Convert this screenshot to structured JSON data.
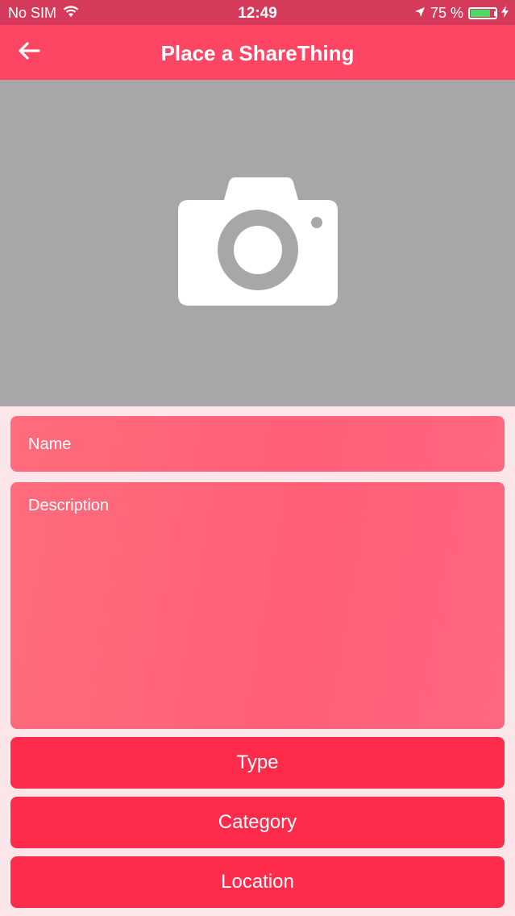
{
  "status_bar": {
    "carrier": "No SIM",
    "time": "12:49",
    "battery_percent": "75 %",
    "battery_level": 0.75,
    "icons": [
      "wifi-icon",
      "location-arrow-icon",
      "battery-icon",
      "charging-bolt-icon"
    ]
  },
  "nav": {
    "title": "Place a ShareThing",
    "back_icon": "arrow-left-icon"
  },
  "photo": {
    "icon": "camera-icon"
  },
  "form": {
    "name_placeholder": "Name",
    "description_placeholder": "Description",
    "type_label": "Type",
    "category_label": "Category",
    "location_label": "Location"
  },
  "colors": {
    "status_bar": "#d63a5a",
    "nav_bar": "#fe4563",
    "photo_bg": "#a7a6a8",
    "field_bg": "#ff6478",
    "button_bg": "#fe2b4b",
    "page_bg": "#fde6ea"
  }
}
